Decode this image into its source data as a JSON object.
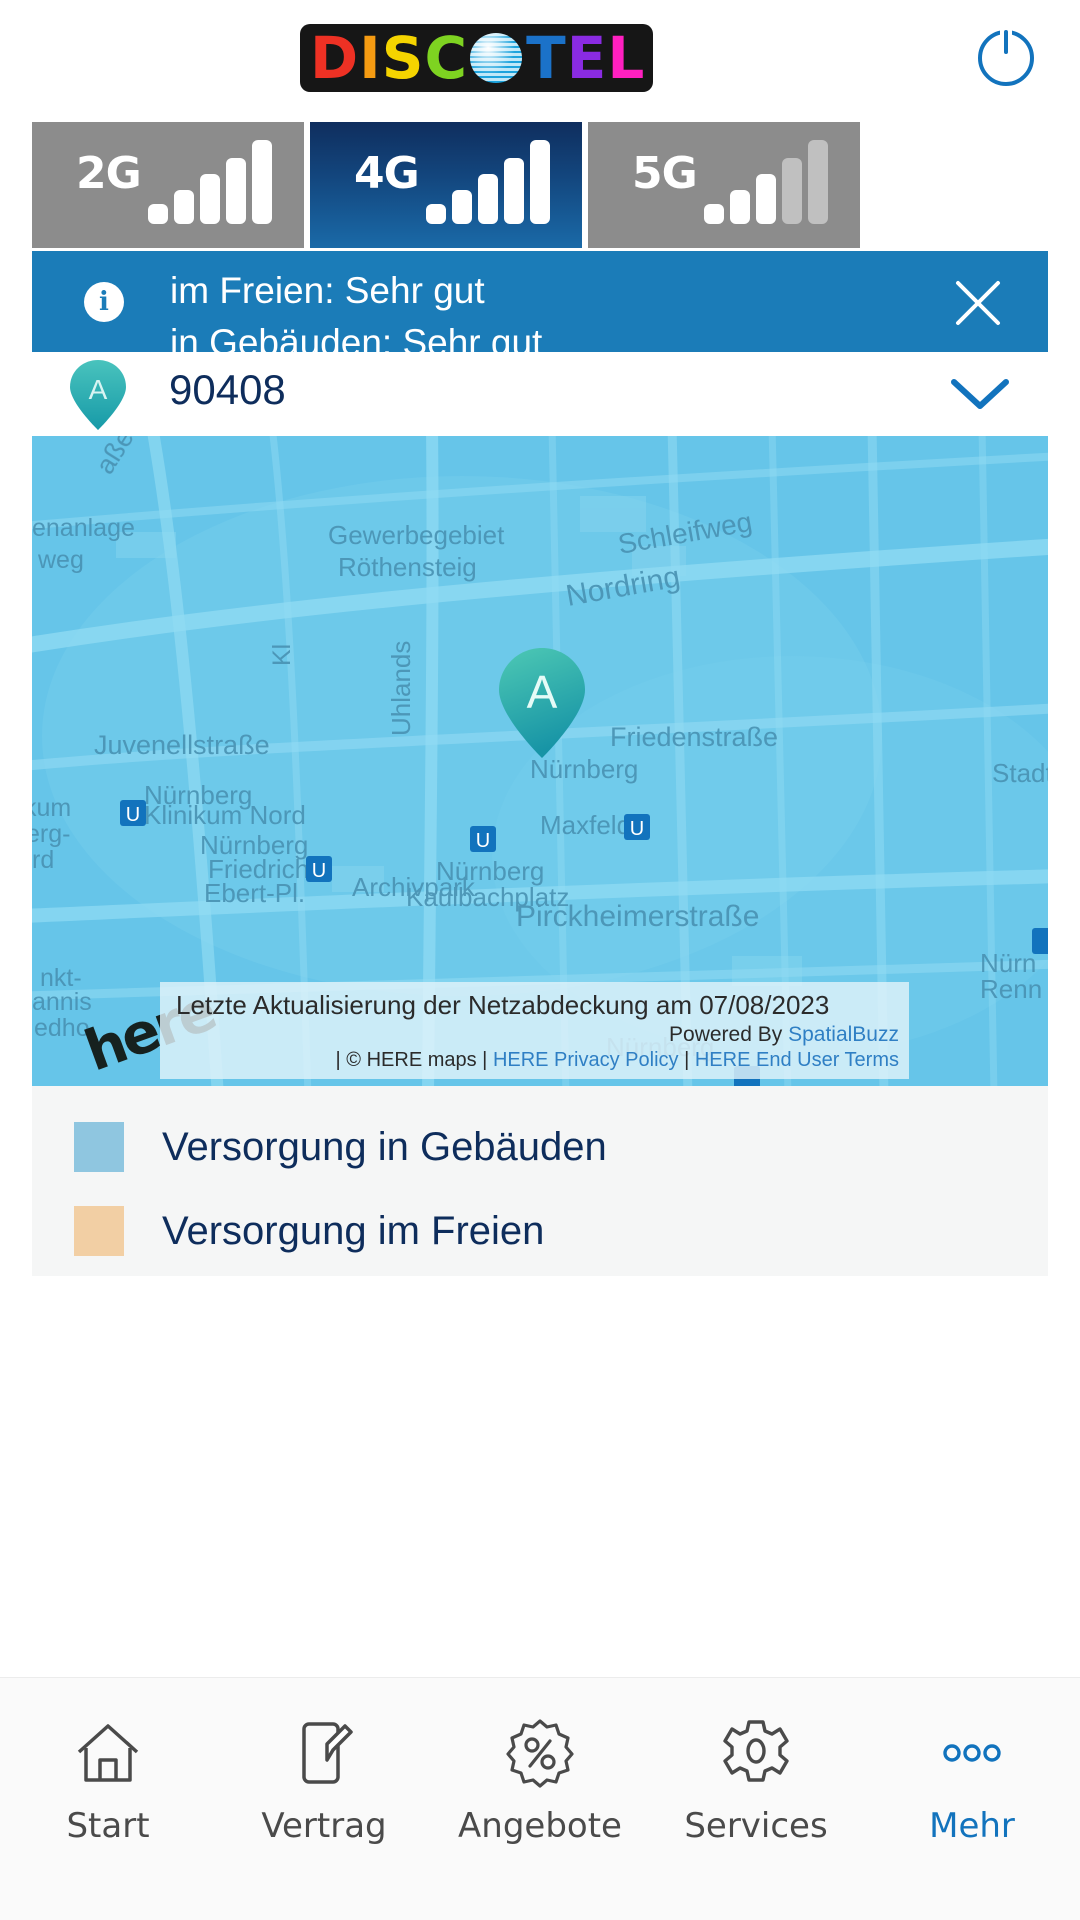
{
  "header": {
    "logo_text": "DISCOTEL",
    "logo_letters": [
      {
        "char": "D",
        "color": "#ee3124"
      },
      {
        "char": "I",
        "color": "#f59b12"
      },
      {
        "char": "S",
        "color": "#f5d400"
      },
      {
        "char": "C",
        "color": "#7ed321"
      },
      {
        "char": "O",
        "color": "#9fdcf3"
      },
      {
        "char": "T",
        "color": "#1b72c9"
      },
      {
        "char": "E",
        "color": "#8a2be2"
      },
      {
        "char": "L",
        "color": "#ff20c0"
      }
    ],
    "power_icon": "power-icon"
  },
  "tech_tabs": [
    {
      "label": "2G",
      "active": false,
      "bars_filled": 5,
      "bars_total": 5
    },
    {
      "label": "4G",
      "active": true,
      "bars_filled": 5,
      "bars_total": 5
    },
    {
      "label": "5G",
      "active": false,
      "bars_filled": 3,
      "bars_total": 5
    }
  ],
  "info_banner": {
    "icon": "info-icon",
    "icon_glyph": "i",
    "line1": "im Freien: Sehr gut",
    "line2": "in Gebäuden: Sehr gut",
    "close_icon": "close-icon",
    "background": "#1b7cb8"
  },
  "location": {
    "pin_letter": "A",
    "zip": "90408",
    "chevron_icon": "chevron-down-icon"
  },
  "map": {
    "pin_letter": "A",
    "provider_logo": "here",
    "labels": [
      "Gewerbegebiet",
      "Röthensteig",
      "Schleifweg",
      "Nordring",
      "enanlage",
      "weg",
      "aße",
      "Juvenellstraße",
      "Friedenstraße",
      "Stadtp",
      "Nürnberg",
      "Klinikum Nord",
      "Nürnberg",
      "Friedrich",
      "Ebert-Pl.",
      "Archivpark",
      "Nürnberg",
      "Kaulbachplatz",
      "Nürnberg",
      "Maxfeld",
      "Pirckheimerstraße",
      "Uhlands",
      "Kl",
      "kum",
      "erg-",
      "rd",
      "nkt-",
      "annis",
      "edho",
      "Nürn",
      "Renn",
      "Nürnberg"
    ],
    "attribution": {
      "update_text": "Letzte Aktualisierung der Netzabdeckung am 07/08/2023",
      "powered_by_prefix": "Powered By ",
      "powered_by_link": "SpatialBuzz",
      "copyright": "| © HERE maps | ",
      "privacy_link": "HERE Privacy Policy",
      "separator": " | ",
      "terms_link": "HERE End User Terms"
    }
  },
  "legend": {
    "items": [
      {
        "label": "Versorgung in Gebäuden",
        "color": "#8fc6e0"
      },
      {
        "label": "Versorgung im Freien",
        "color": "#f2cfa4"
      }
    ]
  },
  "bottom_nav": {
    "items": [
      {
        "label": "Start",
        "icon": "home-icon",
        "active": false
      },
      {
        "label": "Vertrag",
        "icon": "contract-pen-icon",
        "active": false
      },
      {
        "label": "Angebote",
        "icon": "percent-badge-icon",
        "active": false
      },
      {
        "label": "Services",
        "icon": "gear-icon",
        "active": false
      },
      {
        "label": "Mehr",
        "icon": "more-dots-icon",
        "active": true
      }
    ],
    "active_color": "#1273bd"
  }
}
